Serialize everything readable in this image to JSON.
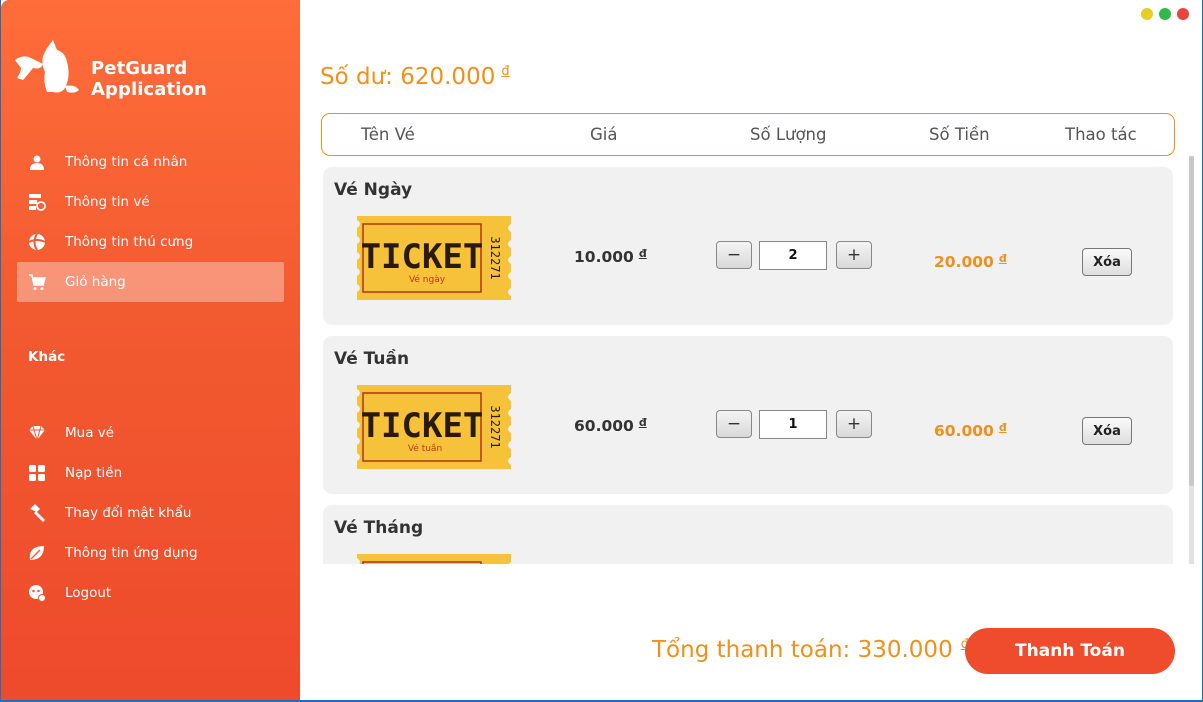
{
  "app": {
    "title": "PetGuard Application"
  },
  "window_controls": [
    {
      "name": "minimize",
      "color": "#e6cf24"
    },
    {
      "name": "maximize",
      "color": "#2fb94a"
    },
    {
      "name": "close",
      "color": "#e8433d"
    }
  ],
  "sidebar": {
    "items": [
      {
        "label": "Thông tin cá nhân",
        "icon": "user-icon"
      },
      {
        "label": "Thông tin vé",
        "icon": "ticket-info-icon"
      },
      {
        "label": "Thông tin thú cưng",
        "icon": "pet-info-icon"
      },
      {
        "label": "Giỏ hàng",
        "icon": "cart-icon",
        "active": true
      }
    ],
    "section_label": "Khác",
    "other_items": [
      {
        "label": "Mua vé",
        "icon": "diamond-icon"
      },
      {
        "label": "Nạp tiền",
        "icon": "grid-icon"
      },
      {
        "label": "Thay đổi mật khẩu",
        "icon": "hammer-icon"
      },
      {
        "label": "Thông tin ứng dụng",
        "icon": "leaf-icon"
      },
      {
        "label": "Logout",
        "icon": "logout-icon"
      }
    ]
  },
  "balance": {
    "label": "Số dư: 620.000",
    "currency": "đ"
  },
  "table": {
    "headers": [
      "Tên Vé",
      "Giá",
      "Số Lượng",
      "Số Tiền",
      "Thao tác"
    ]
  },
  "cart_items": [
    {
      "name": "Vé Ngày",
      "ticket_text": "TICKET",
      "ticket_sub": "Vé ngày",
      "ticket_serial": "312271",
      "price": "10.000",
      "currency": "đ",
      "quantity": "2",
      "amount": "20.000",
      "delete_label": "Xóa",
      "minus_label": "−",
      "plus_label": "+"
    },
    {
      "name": "Vé Tuần",
      "ticket_text": "TICKET",
      "ticket_sub": "Vé tuần",
      "ticket_serial": "312271",
      "price": "60.000",
      "currency": "đ",
      "quantity": "1",
      "amount": "60.000",
      "delete_label": "Xóa",
      "minus_label": "−",
      "plus_label": "+"
    },
    {
      "name": "Vé Tháng"
    }
  ],
  "total": {
    "label": "Tổng thanh toán: 330.000",
    "currency": "đ"
  },
  "pay_button": {
    "label": "Thanh Toán"
  },
  "colors": {
    "accent": "#f0901a",
    "sidebar": "#f25a30",
    "pay": "#ee4c2c"
  }
}
